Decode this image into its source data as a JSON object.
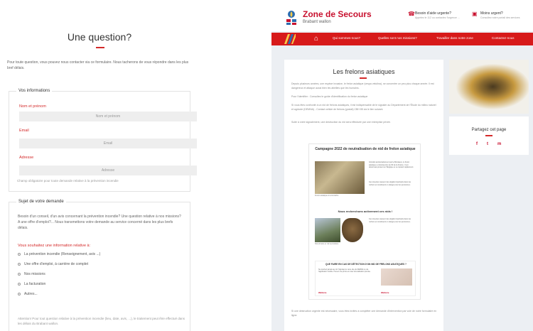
{
  "form": {
    "title": "Une question?",
    "intro": "Pour toute question, vous pouvez nous contacter via ce formulaire. Nous tacherons de vous répondre dans les plus bref délais.",
    "section1_legend": "Vos informations",
    "name_label": "Nom et prénom",
    "name_placeholder": "Nom et prénom",
    "email_label": "Email",
    "email_placeholder": "Email",
    "address_label": "Adresse",
    "address_placeholder": "Adresse",
    "note": "Champ obligatoire pour toute demande relative à la prévention incendie",
    "section2_legend": "Sujet de votre demande",
    "section2_text": "Besoin d'un conseil, d'un avis concernant la prévention incendie? Une question relative à nos missions? A une offre d'emploi?... Nous transmettons votre demande au service concerné dans les plus brefs délais.",
    "info_label": "Vous souhaitez une information relative à:",
    "options": [
      "La prévention incendie (Renseignement, avis ...)",
      "Une offre d'emploi, à carrière de complet",
      "Nos missions",
      "La facturation",
      "Autres..."
    ],
    "footer_note": "Attention! Pour tout question relative à la prévention incendie (lieu, date, avis, ...), le traitement peut être effectué dans les délais du Brabant wallon."
  },
  "site": {
    "logo_title": "Zone de Secours",
    "logo_sub": "Brabant wallon",
    "contact1_title": "Besoin d'aide urgente?",
    "contact1_sub": "Appelez le 112 ou contactez l'urgence ...",
    "contact2_title": "Moins urgent?",
    "contact2_sub": "Consultez notre portail des services",
    "nav": [
      "Qui sommes-nous?",
      "Quelles sont nos missions?",
      "Travailler dans notre zone",
      "Contactez-nous"
    ],
    "article_title": "Les frelons asiatiques",
    "article_p1": "Depuis plusieurs années, une espèce invasive, le frelon asiatique (vespa velutina), se concentre un peu plus chaque année. Il est dangereux et attaque aussi bien les abeilles que les humains.",
    "article_p2": "Pour l'identifier : Consultez le guide d'identification du frelon asiatique",
    "article_p3": "Si vous êtes confronté à un nid de frelons asiatiques, il est indispensable de le signaler au Département de l'Étude du milieu naturel et agricole (DEMNA) - Contact cellule de frelons (gratuit) CBH 85 via le lien suivant.",
    "article_p4": "Suite à votre signalement, une destruction du nid sera effectuée par une entreprise privée.",
    "poster_title": "Campagne 2022 de neutralisation de nid de frelon asiatique",
    "poster_text1": "Introduit accidentellement par le Bordeaux, le frelon asiatique a colonisé plus de 60 de la France. Il est désormais présent en Belgique et se répand rapidement.",
    "poster_text2": "Ces insectes causent des dégâts importants dans les ruchers et constituent un danger pour les personnes.",
    "poster_sub": "Nous recherchons activement ces nids !",
    "poster_box_title": "QUE FAIRE EN CAS DE DÉTECTION D'UN NID DE FRELONS ASIATIQUES ?",
    "poster_box_text": "Ne touchez jamais au nid. Signalez-le via le site du DEMNA ou via l'application mobile. Prenez une photo et notez la localisation précise.",
    "poster_caption1": "Frelon asiatique à reconnaître",
    "poster_caption2": "Nid primaire et nid secondaire",
    "poster_logo1": "Wallonie",
    "poster_logo2": "Wallonie",
    "article_footer": "Si une destruction urgente est nécessaire, vous êtes invités à compléter une demande d'intervention par voie de notre formulaire en ligne.",
    "share_title": "Partagez cet page",
    "social": [
      "f",
      "t",
      "m"
    ]
  }
}
